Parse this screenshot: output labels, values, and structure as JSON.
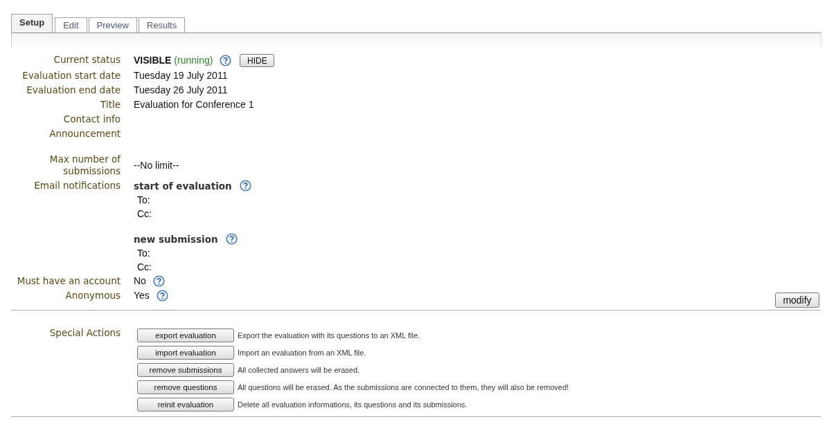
{
  "tabs": [
    {
      "label": "Setup",
      "selected": true
    },
    {
      "label": "Edit",
      "selected": false
    },
    {
      "label": "Preview",
      "selected": false
    },
    {
      "label": "Results",
      "selected": false
    }
  ],
  "fields": [
    {
      "kind": "status",
      "label": "Current status",
      "status": "VISIBLE",
      "state": "(running)",
      "help": true,
      "button": "HIDE"
    },
    {
      "kind": "text",
      "label": "Evaluation start date",
      "value": "Tuesday 19 July 2011"
    },
    {
      "kind": "text",
      "label": "Evaluation end date",
      "value": "Tuesday 26 July 2011"
    },
    {
      "kind": "text",
      "label": "Title",
      "value": "Evaluation for Conference 1"
    },
    {
      "kind": "text",
      "label": "Contact info"
    },
    {
      "kind": "text",
      "label": "Announcement"
    },
    {
      "kind": "text",
      "label": "Max number of submissions",
      "value": "--No limit--"
    },
    {
      "kind": "notifications",
      "label": "Email notifications",
      "groups": [
        {
          "title": "start of evaluation",
          "help": true,
          "to": "To:",
          "cc": "Cc:"
        },
        {
          "title": "new submission",
          "help": true,
          "to": "To:",
          "cc": "Cc:"
        }
      ]
    },
    {
      "kind": "text",
      "label": "Must have an account",
      "value": "No",
      "help": true
    },
    {
      "kind": "text",
      "label": "Anonymous",
      "value": "Yes",
      "help": true
    }
  ],
  "modify_button": "modify",
  "special_actions": {
    "label": "Special Actions",
    "actions": [
      {
        "button": "export evaluation",
        "description": "Export the evaluation with its questions to an XML file."
      },
      {
        "button": "import evaluation",
        "description": "Import an evaluation from an XML file."
      },
      {
        "button": "remove submissions",
        "description": "All collected answers will be erased."
      },
      {
        "button": "remove questions",
        "description": "All questions will be erased. As the submissions are connected to them, they will also be removed!"
      },
      {
        "button": "reinit evaluation",
        "description": "Delete all evaluation informations, its questions and its submissions."
      }
    ]
  }
}
